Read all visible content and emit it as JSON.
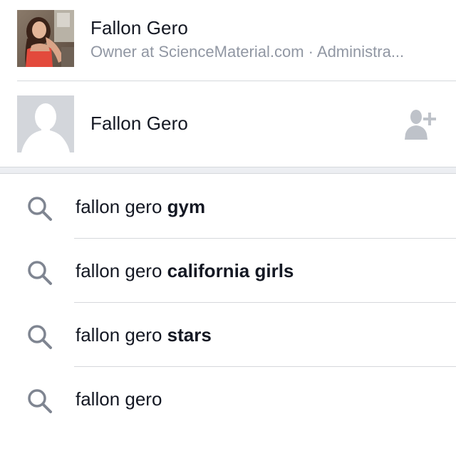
{
  "people": [
    {
      "name": "Fallon Gero",
      "subtitle": "Owner at ScienceMaterial.com · Administra...",
      "avatar": "photo-avatar"
    },
    {
      "name": "Fallon Gero",
      "avatar": "silhouette-avatar",
      "action_icon": "add-friend-icon"
    }
  ],
  "suggestions": [
    {
      "prefix": "fallon gero ",
      "bold": "gym"
    },
    {
      "prefix": "fallon gero ",
      "bold": "california girls"
    },
    {
      "prefix": "fallon gero ",
      "bold": "stars"
    },
    {
      "prefix": "fallon gero",
      "bold": ""
    }
  ],
  "colors": {
    "text_primary": "#141823",
    "text_secondary": "#9197a3",
    "divider": "#d6d8dc",
    "section_gap": "#eceef2",
    "icon_gray": "#bec2c9",
    "search_icon": "#7f8591"
  }
}
